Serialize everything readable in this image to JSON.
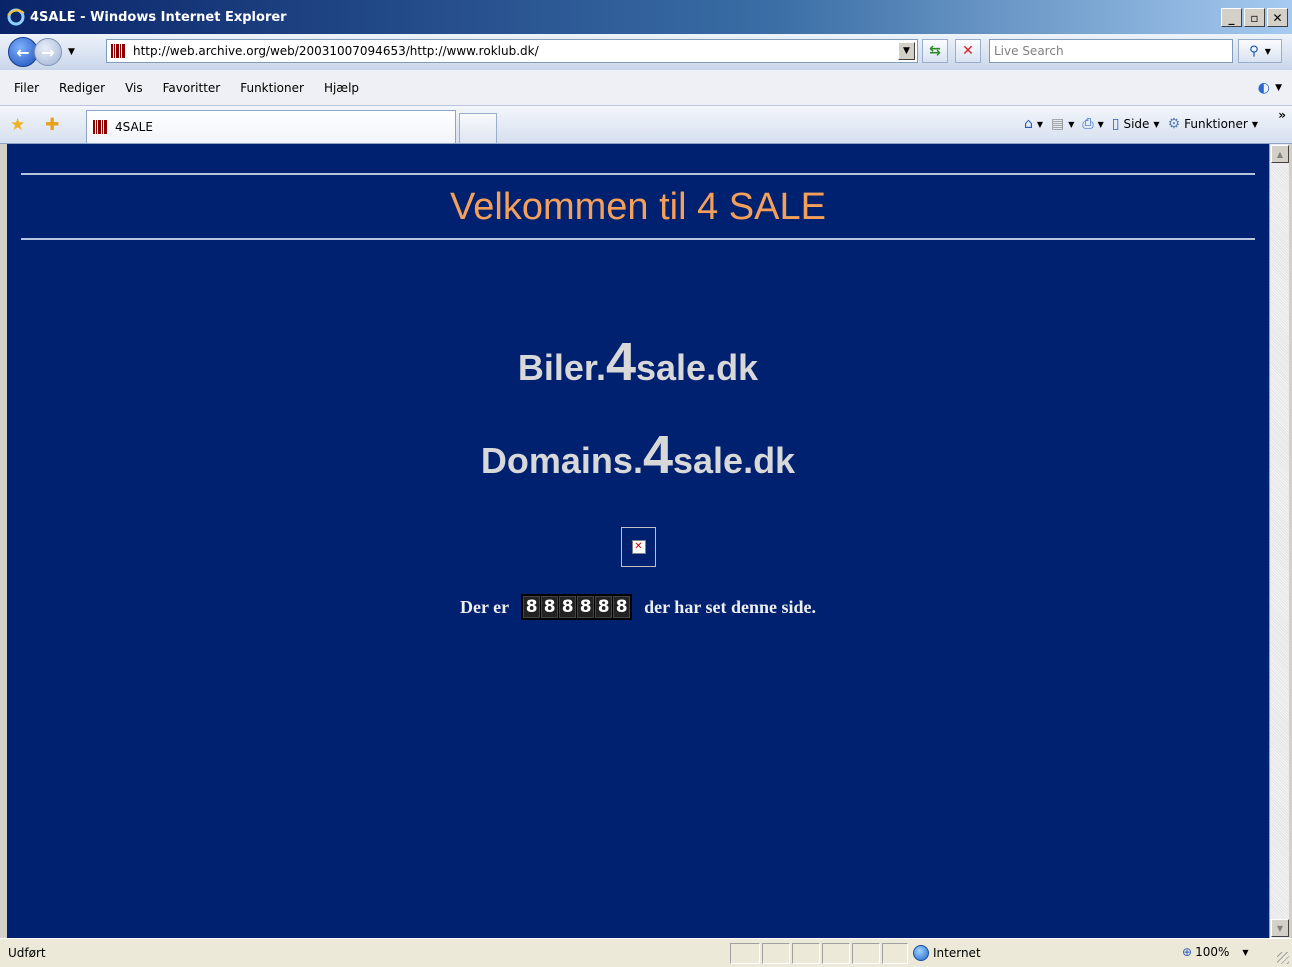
{
  "window": {
    "title": "4SALE - Windows Internet Explorer"
  },
  "address_bar": {
    "url": "http://web.archive.org/web/20031007094653/http://www.roklub.dk/",
    "search_placeholder": "Live Search"
  },
  "menu": {
    "items": [
      "Filer",
      "Rediger",
      "Vis",
      "Favoritter",
      "Funktioner",
      "Hjælp"
    ]
  },
  "tabs": {
    "active_label": "4SALE"
  },
  "command_bar": {
    "page_label": "Side",
    "tools_label": "Funktioner"
  },
  "page": {
    "background": "#002070",
    "welcome": "Velkommen til 4 SALE",
    "welcome_color": "#f4a05a",
    "links": [
      {
        "prefix": "Biler.",
        "big": "4",
        "suffix": "sale.dk"
      },
      {
        "prefix": "Domains.",
        "big": "4",
        "suffix": "sale.dk"
      }
    ],
    "counter_prefix": "Der er",
    "counter_digits": [
      "8",
      "8",
      "8",
      "8",
      "8",
      "8"
    ],
    "counter_suffix": "der har set denne side."
  },
  "status_bar": {
    "status": "Udført",
    "zone": "Internet",
    "zoom": "100%"
  }
}
